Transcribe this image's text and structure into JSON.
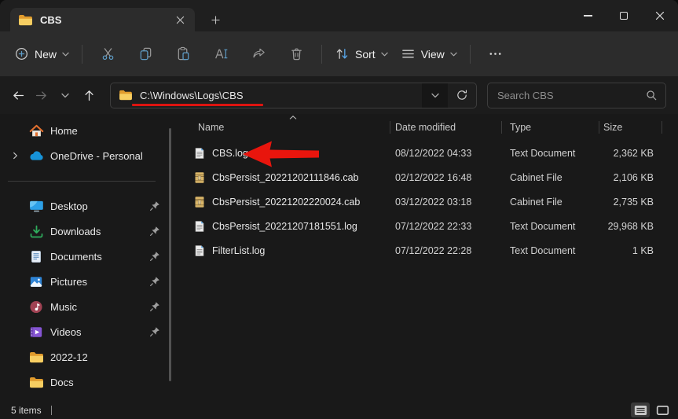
{
  "tab_bar": {
    "tab_label": "CBS"
  },
  "toolbar": {
    "new_label": "New",
    "sort_label": "Sort",
    "view_label": "View"
  },
  "address_bar": {
    "path": "C:\\Windows\\Logs\\CBS"
  },
  "search": {
    "placeholder": "Search CBS"
  },
  "sidebar": {
    "items": [
      {
        "label": "Home",
        "icon": "home-icon",
        "pinned": false
      },
      {
        "label": "OneDrive - Personal",
        "icon": "onedrive-cloud-icon",
        "pinned": false,
        "expandable": true
      },
      {
        "label": "Desktop",
        "icon": "desktop-icon",
        "pinned": true
      },
      {
        "label": "Downloads",
        "icon": "downloads-icon",
        "pinned": true
      },
      {
        "label": "Documents",
        "icon": "documents-icon",
        "pinned": true
      },
      {
        "label": "Pictures",
        "icon": "pictures-icon",
        "pinned": true
      },
      {
        "label": "Music",
        "icon": "music-icon",
        "pinned": true
      },
      {
        "label": "Videos",
        "icon": "videos-icon",
        "pinned": true
      },
      {
        "label": "2022-12",
        "icon": "folder-icon",
        "pinned": false
      },
      {
        "label": "Docs",
        "icon": "folder-icon",
        "pinned": false
      }
    ]
  },
  "file_list": {
    "columns": [
      {
        "label": "Name"
      },
      {
        "label": "Date modified"
      },
      {
        "label": "Type"
      },
      {
        "label": "Size"
      }
    ],
    "sort": {
      "column": "Name",
      "direction": "ascending"
    },
    "rows": [
      {
        "name": "CBS.log",
        "date_modified": "08/12/2022 04:33",
        "type": "Text Document",
        "size": "2,362 KB",
        "icon": "text-document-icon"
      },
      {
        "name": "CbsPersist_20221202111846.cab",
        "date_modified": "02/12/2022 16:48",
        "type": "Cabinet File",
        "size": "2,106 KB",
        "icon": "cabinet-file-icon"
      },
      {
        "name": "CbsPersist_20221202220024.cab",
        "date_modified": "03/12/2022 03:18",
        "type": "Cabinet File",
        "size": "2,735 KB",
        "icon": "cabinet-file-icon"
      },
      {
        "name": "CbsPersist_20221207181551.log",
        "date_modified": "07/12/2022 22:33",
        "type": "Text Document",
        "size": "29,968 KB",
        "icon": "text-document-icon"
      },
      {
        "name": "FilterList.log",
        "date_modified": "07/12/2022 22:28",
        "type": "Text Document",
        "size": "1 KB",
        "icon": "text-document-icon"
      }
    ]
  },
  "status_bar": {
    "items_text": "5 items"
  },
  "annotations": {
    "arrow_color": "#e8150d",
    "underline_color": "#dd1410",
    "arrow_target": "CBS.log",
    "underline_target": "address path"
  },
  "colors": {
    "accent_blue": "#5e9dc8",
    "folder_yellow": "#f7ce62",
    "window_bg": "#191919",
    "toolbar_bg": "#2c2c2c"
  }
}
